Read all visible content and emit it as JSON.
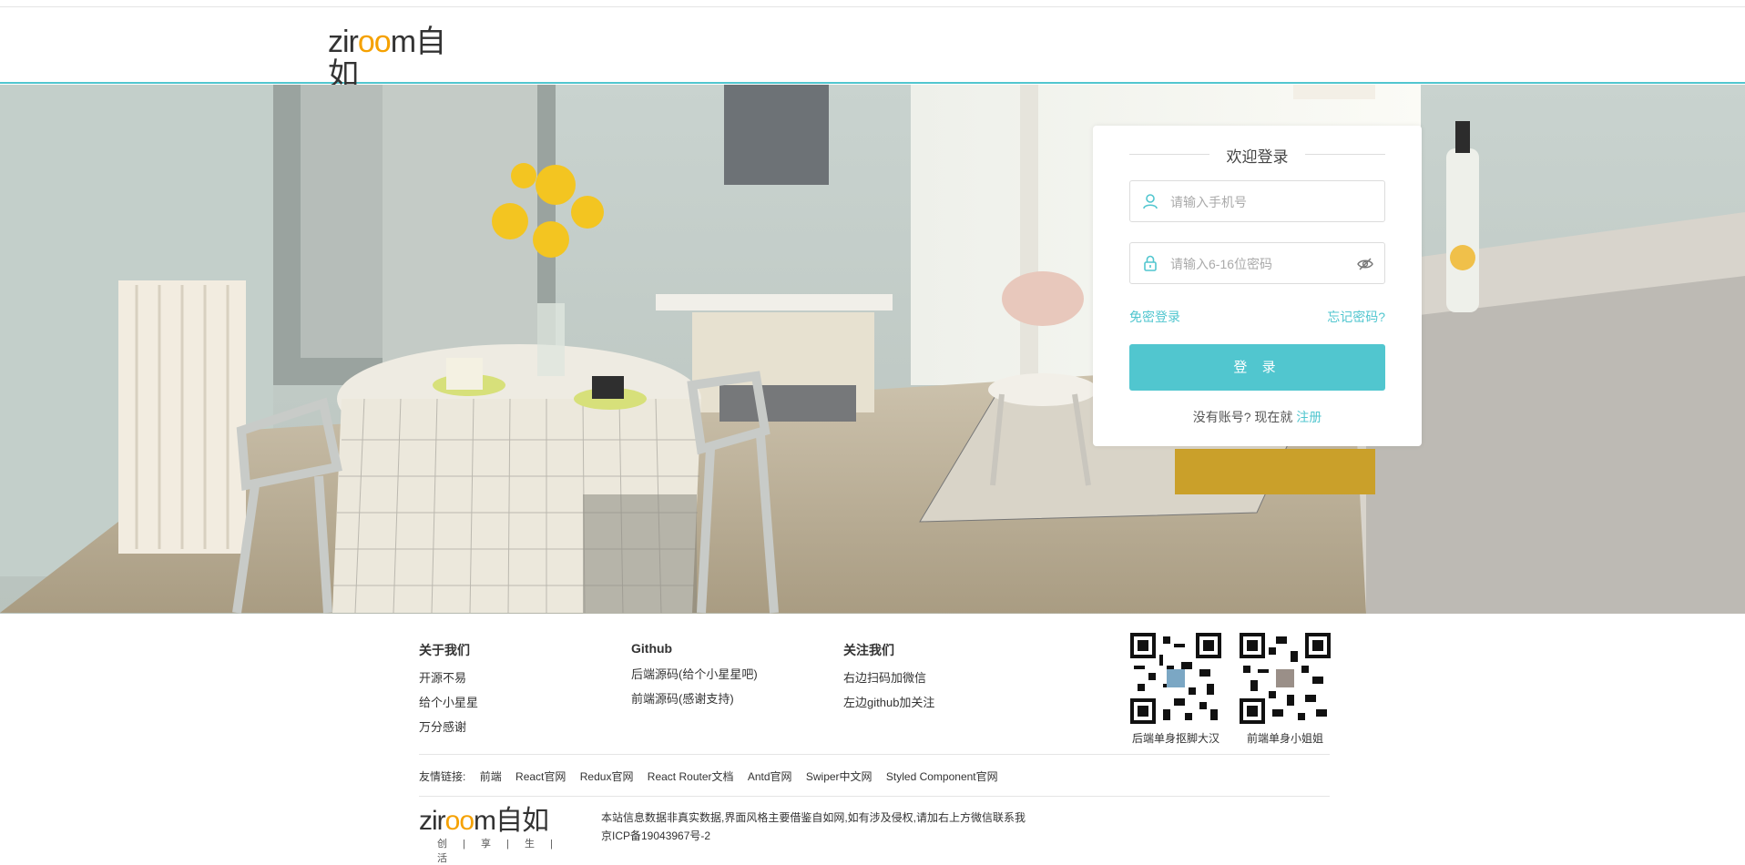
{
  "brand": {
    "logo_word_a": "zir",
    "logo_word_b": "oo",
    "logo_word_c": "m",
    "logo_cn": "自如",
    "logo_sub": "创 | 享 | 生 | 活",
    "accent": "#51c6cf",
    "logo_accent": "#f5a100"
  },
  "login": {
    "title": "欢迎登录",
    "phone_placeholder": "请输入手机号",
    "password_placeholder": "请输入6-16位密码",
    "passwordless_link": "免密登录",
    "forgot_link": "忘记密码?",
    "submit_label": "登 录",
    "register_prompt": "没有账号? 现在就",
    "register_link": "注册"
  },
  "footer": {
    "columns": [
      {
        "title": "关于我们",
        "items": [
          "开源不易",
          "给个小星星",
          "万分感谢"
        ]
      },
      {
        "title": "Github",
        "items": [
          "后端源码(给个小星星吧)",
          "前端源码(感谢支持)"
        ]
      },
      {
        "title": "关注我们",
        "items": [
          "右边扫码加微信",
          "左边github加关注"
        ]
      }
    ],
    "qr_codes": [
      {
        "caption": "后端单身抠脚大汉"
      },
      {
        "caption": "前端单身小姐姐"
      }
    ],
    "friends_label": "友情链接:",
    "friends": [
      "前端",
      "React官网",
      "Redux官网",
      "React Router文档",
      "Antd官网",
      "Swiper中文网",
      "Styled Component官网"
    ],
    "notice_line1": "本站信息数据非真实数据,界面风格主要借鉴自如网,如有涉及侵权,请加右上方微信联系我",
    "notice_line2": "京ICP备19043967号-2"
  }
}
